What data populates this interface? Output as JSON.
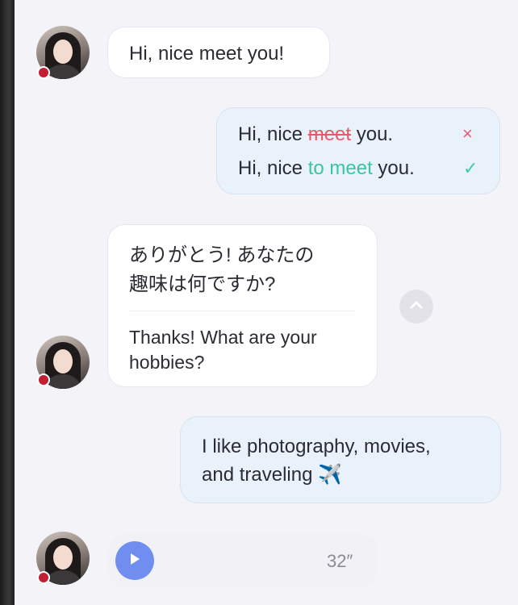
{
  "messages": {
    "greeting": {
      "text": "Hi, nice meet you!"
    },
    "correction": {
      "wrong_prefix": "Hi, nice ",
      "wrong_word": "meet",
      "wrong_suffix": " you.",
      "right_prefix": "Hi, nice ",
      "right_word": "to meet",
      "right_suffix": " you.",
      "wrong_mark": "×",
      "right_mark": "✓"
    },
    "question": {
      "original_line1": "ありがとう! あなたの",
      "original_line2": "趣味は何ですか?",
      "translation_line1": "Thanks! What are your",
      "translation_line2": "hobbies?"
    },
    "reply": {
      "line1": "I like photography, movies,",
      "line2": "and traveling",
      "emoji": "✈️"
    },
    "voice": {
      "duration": "32″"
    }
  },
  "colors": {
    "status_dot": "#c41e33",
    "play_button": "#6f8ef0",
    "correction_red": "#e65a66",
    "correction_green": "#3cc4a4"
  },
  "icons": {
    "collapse": "chevron-up-icon",
    "play": "play-icon"
  }
}
